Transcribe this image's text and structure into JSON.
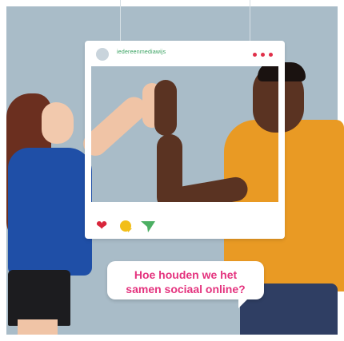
{
  "post": {
    "handle": "iedereenmediawijs",
    "menu_icon": "three-dots-icon",
    "action_icons": [
      "heart-icon",
      "comment-bubble-icon",
      "send-icon"
    ],
    "colors": {
      "handle": "#37a15f",
      "heart": "#d8263b",
      "comment": "#f2be19",
      "send": "#4caf63",
      "dots": "#e0304a"
    }
  },
  "speech_bubble": {
    "line1": "Hoe houden we het",
    "line2": "samen sociaal online?",
    "text_color": "#e4337e"
  }
}
